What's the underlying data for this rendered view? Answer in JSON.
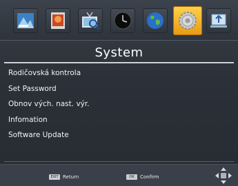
{
  "tabs": [
    {
      "icon": "picture-tab-icon"
    },
    {
      "icon": "image-edit-tab-icon"
    },
    {
      "icon": "search-tv-tab-icon"
    },
    {
      "icon": "clock-tab-icon"
    },
    {
      "icon": "globe-tab-icon"
    },
    {
      "icon": "system-tab-icon",
      "active": true
    },
    {
      "icon": "usb-tab-icon"
    }
  ],
  "page": {
    "title": "System"
  },
  "menu": {
    "items": [
      {
        "label": "Rodičovská kontrola"
      },
      {
        "label": "Set Password"
      },
      {
        "label": "Obnov vých. nast. výr."
      },
      {
        "label": "Infomation"
      },
      {
        "label": "Software Update"
      }
    ]
  },
  "footer": {
    "return": {
      "key": "EXIT",
      "label": "Return"
    },
    "confirm": {
      "key": "OK",
      "label": "Confirm"
    }
  },
  "colors": {
    "accent": "#f2b02a",
    "background": "#2b3038",
    "text": "#ffffff"
  }
}
